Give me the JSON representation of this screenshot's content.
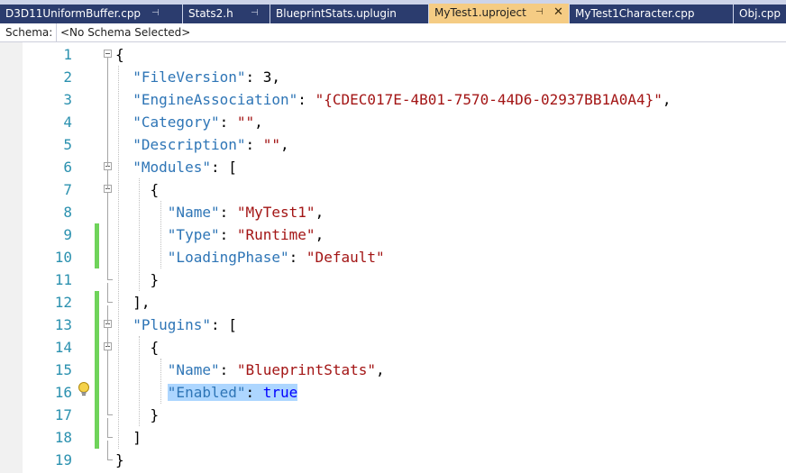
{
  "tabs": [
    {
      "label": "D3D11UniformBuffer.cpp",
      "pinned": true,
      "active": false
    },
    {
      "label": "Stats2.h",
      "pinned": true,
      "active": false
    },
    {
      "label": "BlueprintStats.uplugin",
      "pinned": false,
      "active": false
    },
    {
      "label": "MyTest1.uproject",
      "pinned": true,
      "active": true
    },
    {
      "label": "MyTest1Character.cpp",
      "pinned": false,
      "active": false
    },
    {
      "label": "Obj.cpp",
      "pinned": false,
      "active": false
    }
  ],
  "schema": {
    "label": "Schema:",
    "value": "<No Schema Selected>"
  },
  "editor": {
    "lines": [
      {
        "n": "1",
        "t": [
          [
            "pun",
            "{"
          ]
        ]
      },
      {
        "n": "2",
        "t": [
          [
            "pun",
            "  "
          ],
          [
            "key",
            "\"FileVersion\""
          ],
          [
            "pun",
            ": "
          ],
          [
            "num",
            "3"
          ],
          [
            "pun",
            ","
          ]
        ]
      },
      {
        "n": "3",
        "t": [
          [
            "pun",
            "  "
          ],
          [
            "key",
            "\"EngineAssociation\""
          ],
          [
            "pun",
            ": "
          ],
          [
            "str",
            "\"{CDEC017E-4B01-7570-44D6-02937BB1A0A4}\""
          ],
          [
            "pun",
            ","
          ]
        ]
      },
      {
        "n": "4",
        "t": [
          [
            "pun",
            "  "
          ],
          [
            "key",
            "\"Category\""
          ],
          [
            "pun",
            ": "
          ],
          [
            "str",
            "\"\""
          ],
          [
            "pun",
            ","
          ]
        ]
      },
      {
        "n": "5",
        "t": [
          [
            "pun",
            "  "
          ],
          [
            "key",
            "\"Description\""
          ],
          [
            "pun",
            ": "
          ],
          [
            "str",
            "\"\""
          ],
          [
            "pun",
            ","
          ]
        ]
      },
      {
        "n": "6",
        "t": [
          [
            "pun",
            "  "
          ],
          [
            "key",
            "\"Modules\""
          ],
          [
            "pun",
            ": ["
          ]
        ]
      },
      {
        "n": "7",
        "t": [
          [
            "pun",
            "    {"
          ]
        ]
      },
      {
        "n": "8",
        "t": [
          [
            "pun",
            "      "
          ],
          [
            "key",
            "\"Name\""
          ],
          [
            "pun",
            ": "
          ],
          [
            "str",
            "\"MyTest1\""
          ],
          [
            "pun",
            ","
          ]
        ]
      },
      {
        "n": "9",
        "t": [
          [
            "pun",
            "      "
          ],
          [
            "key",
            "\"Type\""
          ],
          [
            "pun",
            ": "
          ],
          [
            "str",
            "\"Runtime\""
          ],
          [
            "pun",
            ","
          ]
        ]
      },
      {
        "n": "10",
        "t": [
          [
            "pun",
            "      "
          ],
          [
            "key",
            "\"LoadingPhase\""
          ],
          [
            "pun",
            ": "
          ],
          [
            "str",
            "\"Default\""
          ]
        ]
      },
      {
        "n": "11",
        "t": [
          [
            "pun",
            "    }"
          ]
        ]
      },
      {
        "n": "12",
        "t": [
          [
            "pun",
            "  ],"
          ]
        ]
      },
      {
        "n": "13",
        "t": [
          [
            "pun",
            "  "
          ],
          [
            "key",
            "\"Plugins\""
          ],
          [
            "pun",
            ": ["
          ]
        ]
      },
      {
        "n": "14",
        "t": [
          [
            "pun",
            "    {"
          ]
        ]
      },
      {
        "n": "15",
        "t": [
          [
            "pun",
            "      "
          ],
          [
            "key",
            "\"Name\""
          ],
          [
            "pun",
            ": "
          ],
          [
            "str",
            "\"BlueprintStats\""
          ],
          [
            "pun",
            ","
          ]
        ]
      },
      {
        "n": "16",
        "t": [
          [
            "pun",
            "      "
          ],
          [
            "key",
            "\"Enabled\"",
            "sel"
          ],
          [
            "pun",
            ": ",
            "sel"
          ],
          [
            "bool",
            "true",
            "sel"
          ]
        ]
      },
      {
        "n": "17",
        "t": [
          [
            "pun",
            "    }"
          ]
        ]
      },
      {
        "n": "18",
        "t": [
          [
            "pun",
            "  ]"
          ]
        ]
      },
      {
        "n": "19",
        "t": [
          [
            "pun",
            "}"
          ]
        ]
      }
    ],
    "changed_lines": [
      9,
      10,
      12,
      13,
      14,
      15,
      16,
      17,
      18
    ],
    "fold_lines": [
      1,
      6,
      7,
      13,
      14
    ]
  },
  "colors": {
    "key": "#2e75b6",
    "string": "#a31515",
    "bool": "#0000ff",
    "line_number": "#2b91af",
    "change_marker": "#6fd35a",
    "active_tab": "#f5cc84",
    "inactive_tab": "#2b3c6e",
    "selection": "#add6ff"
  },
  "icons": {
    "lightbulb": "lightbulb-icon",
    "pin": "pin-icon",
    "close": "close-icon"
  }
}
